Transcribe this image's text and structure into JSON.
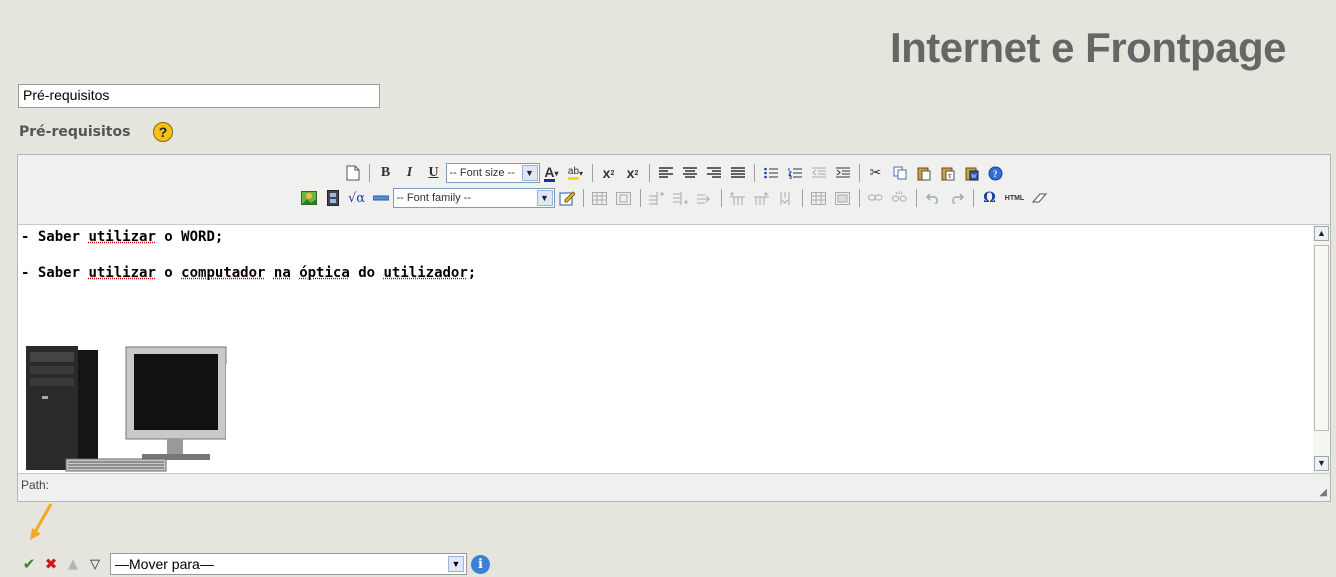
{
  "header": {
    "title": "Internet e Frontpage"
  },
  "form": {
    "title_value": "Pré-requisitos",
    "field_label": "Pré-requisitos",
    "help_glyph": "?"
  },
  "toolbar": {
    "font_size_select": "-- Font size --",
    "font_family_select": "-- Font family --",
    "html_button": "HTML"
  },
  "editor": {
    "lines": [
      [
        "- Saber ",
        {
          "w": "utilizar"
        },
        " o WORD;"
      ],
      [
        "- Saber ",
        {
          "w": "utilizar"
        },
        " o ",
        {
          "w": "computador"
        },
        " ",
        {
          "w": "na"
        },
        " ",
        {
          "w": "óptica"
        },
        " do ",
        {
          "w": "utilizador"
        },
        ";"
      ]
    ],
    "status_path_label": "Path:"
  },
  "actions": {
    "move_select_value": "—Mover para—",
    "info_glyph": "i"
  },
  "colors": {
    "background": "#e5e5de",
    "spell_underline": "#cc0000",
    "arrow": "#f5a623"
  }
}
